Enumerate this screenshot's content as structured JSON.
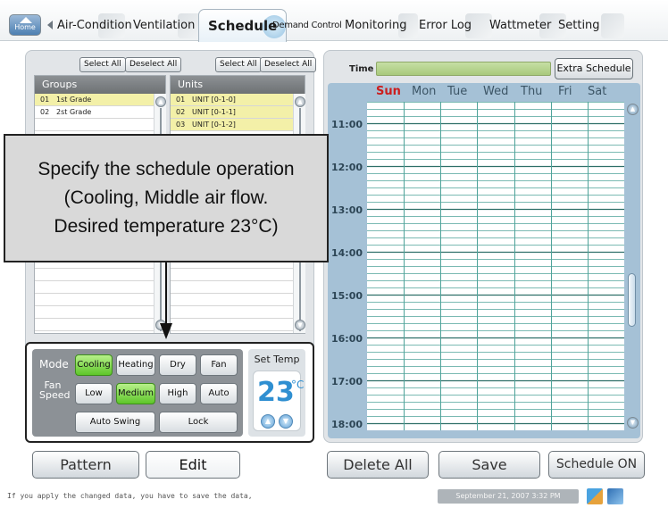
{
  "tabs": {
    "home": "Home",
    "items": [
      "Air-Condition",
      "Ventilation",
      "Schedule",
      "Demand Control",
      "Monitoring",
      "Error Log",
      "Wattmeter",
      "Setting"
    ],
    "active": "Schedule"
  },
  "groups": {
    "select_all": "Select All",
    "deselect_all": "Deselect All",
    "header": "Groups",
    "rows": [
      {
        "num": "01",
        "name": "1st Grade",
        "selected": true
      },
      {
        "num": "02",
        "name": "2st Grade",
        "selected": false
      }
    ]
  },
  "units": {
    "select_all": "Select All",
    "deselect_all": "Deselect All",
    "header": "Units",
    "rows": [
      {
        "num": "01",
        "name": "UNIT [0-1-0]",
        "selected": true
      },
      {
        "num": "02",
        "name": "UNIT [0-1-1]",
        "selected": true
      },
      {
        "num": "03",
        "name": "UNIT [0-1-2]",
        "selected": true
      }
    ]
  },
  "callout": {
    "line1": "Specify the schedule operation",
    "line2": "(Cooling, Middle air flow.",
    "line3": "Desired temperature 23°C)"
  },
  "mode": {
    "label": "Mode",
    "options": [
      "Cooling",
      "Heating",
      "Dry",
      "Fan"
    ],
    "selected": "Cooling"
  },
  "fan_speed": {
    "label_line1": "Fan",
    "label_line2": "Speed",
    "options": [
      "Low",
      "Medium",
      "High",
      "Auto"
    ],
    "selected": "Medium"
  },
  "auto_swing": "Auto Swing",
  "lock": "Lock",
  "set_temp": {
    "label": "Set Temp",
    "value": "23",
    "unit": "°C"
  },
  "schedule": {
    "time_label": "Time",
    "extra_schedule": "Extra Schedule",
    "days": [
      "Sun",
      "Mon",
      "Tue",
      "Wed",
      "Thu",
      "Fri",
      "Sat"
    ],
    "hours": [
      "11:00",
      "12:00",
      "13:00",
      "14:00",
      "15:00",
      "16:00",
      "17:00",
      "18:00"
    ]
  },
  "buttons": {
    "pattern": "Pattern",
    "edit": "Edit",
    "delete_all": "Delete All",
    "save": "Save",
    "schedule_on": "Schedule ON"
  },
  "footer": {
    "message": "If you apply the changed data,  you have to save the data,",
    "datetime": "September 21, 2007 3:32 PM"
  },
  "colors": {
    "selected_button": "#5ec62a",
    "selected_row": "#f3f0a8",
    "sunday": "#cc1e1e",
    "temperature": "#2f8fd1",
    "grid_line": "#4fa39a"
  }
}
